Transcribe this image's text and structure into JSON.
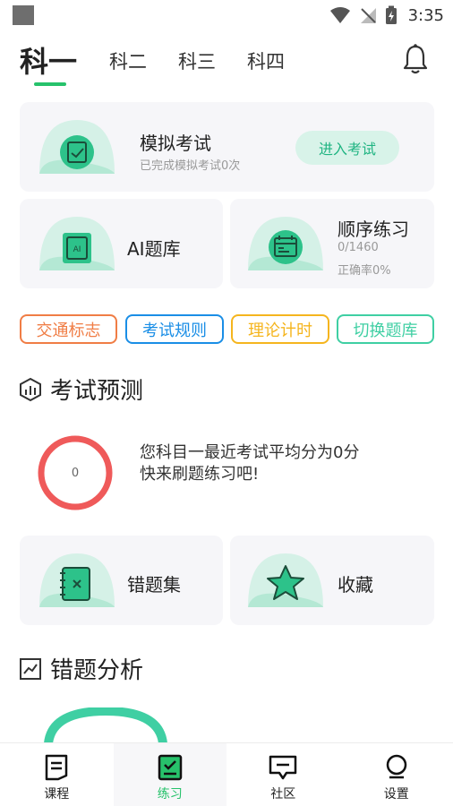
{
  "status_bar": {
    "time": "3:35"
  },
  "subject_tabs": {
    "active": "科一",
    "others": [
      "科二",
      "科三",
      "科四"
    ]
  },
  "mock_exam": {
    "title": "模拟考试",
    "subtitle": "已完成模拟考试0次",
    "button": "进入考试"
  },
  "ai_bank": {
    "title": "AI题库"
  },
  "sequential": {
    "title": "顺序练习",
    "progress": "0/1460",
    "accuracy": "正确率0%"
  },
  "chips": [
    "交通标志",
    "考试规则",
    "理论计时",
    "切换题库"
  ],
  "prediction": {
    "title": "考试预测",
    "score": "0",
    "line1": "您科目一最近考试平均分为0分",
    "line2": "快来刷题练习吧!"
  },
  "wrong_set": {
    "title": "错题集"
  },
  "favorites": {
    "title": "收藏"
  },
  "wrong_analysis": {
    "title": "错题分析"
  },
  "bottom_nav": {
    "items": [
      {
        "label": "课程",
        "icon": "document-icon"
      },
      {
        "label": "练习",
        "icon": "checklist-icon"
      },
      {
        "label": "社区",
        "icon": "chat-icon"
      },
      {
        "label": "设置",
        "icon": "bulb-icon"
      }
    ],
    "active_index": 1
  },
  "colors": {
    "accent": "#27c26b",
    "chip_colors": [
      "#f07d45",
      "#1a8ee6",
      "#f5b51e",
      "#3fcfa3"
    ],
    "ring": "#ef5a5a"
  }
}
